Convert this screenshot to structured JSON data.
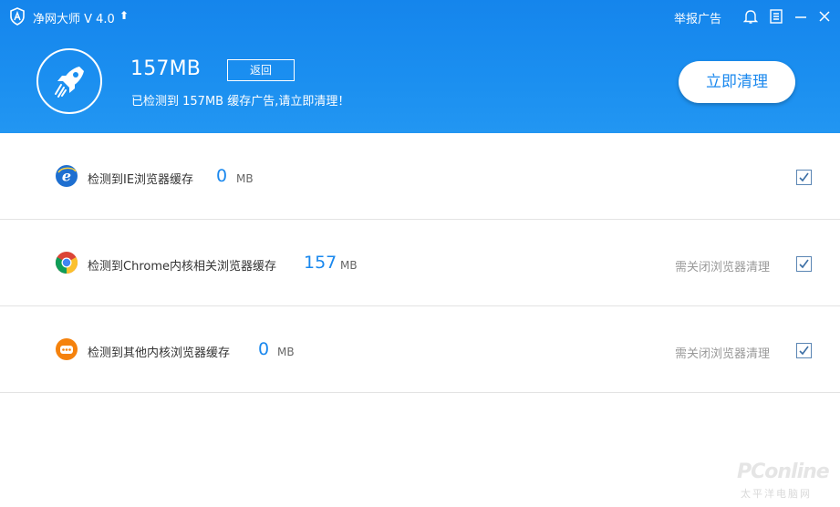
{
  "app": {
    "title": "净网大师 V 4.0",
    "update_icon": "up-arrow-icon",
    "report_link": "举报广告"
  },
  "summary": {
    "size": "157MB",
    "back_label": "返回",
    "status": "已检测到 157MB 缓存广告,请立即清理！",
    "clean_label": "立即清理"
  },
  "items": [
    {
      "icon": "ie-icon",
      "label": "检测到IE浏览器缓存",
      "size": "0",
      "unit": "MB",
      "note": "",
      "checked": true
    },
    {
      "icon": "chrome-icon",
      "label": "检测到Chrome内核相关浏览器缓存",
      "size": "157",
      "unit": "MB",
      "note": "需关闭浏览器清理",
      "checked": true
    },
    {
      "icon": "other-browser-icon",
      "label": "检测到其他内核浏览器缓存",
      "size": "0",
      "unit": "MB",
      "note": "需关闭浏览器清理",
      "checked": true
    }
  ],
  "watermark": {
    "main": "PConline",
    "sub": "太平洋电脑网"
  },
  "colors": {
    "header": "#1b8ff0",
    "accent": "#1a88ee",
    "ie": "#1e6fd0",
    "other": "#f5820d"
  }
}
